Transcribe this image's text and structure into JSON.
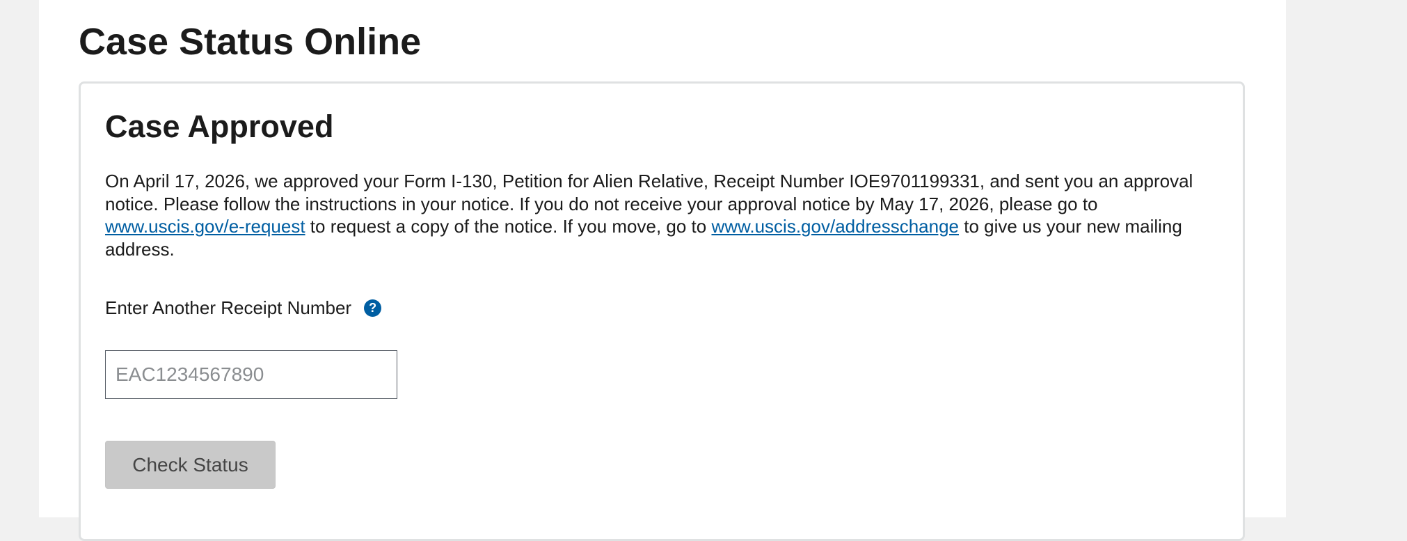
{
  "page": {
    "title": "Case Status Online"
  },
  "case": {
    "heading": "Case Approved",
    "body": {
      "part1": "On April 17, 2026, we approved your Form I-130, Petition for Alien Relative, Receipt Number IOE9701199331, and sent you an approval notice. Please follow the instructions in your notice. If you do not receive your approval notice by May 17, 2026, please go to ",
      "link1": "www.uscis.gov/e-request",
      "part2": " to request a copy of the notice. If you move, go to ",
      "link2": "www.uscis.gov/addresschange",
      "part3": " to give us your new mailing address."
    }
  },
  "form": {
    "receipt_label": "Enter Another Receipt Number",
    "help_icon_glyph": "?",
    "receipt_value": "",
    "receipt_placeholder": "EAC1234567890",
    "check_button_label": "Check Status"
  },
  "icons": {
    "help": "question-circle-icon"
  },
  "colors": {
    "link": "#005ea2",
    "help_icon": "#005ea2",
    "button_bg": "#c9c9c9",
    "page_bg": "#f1f1f1"
  }
}
